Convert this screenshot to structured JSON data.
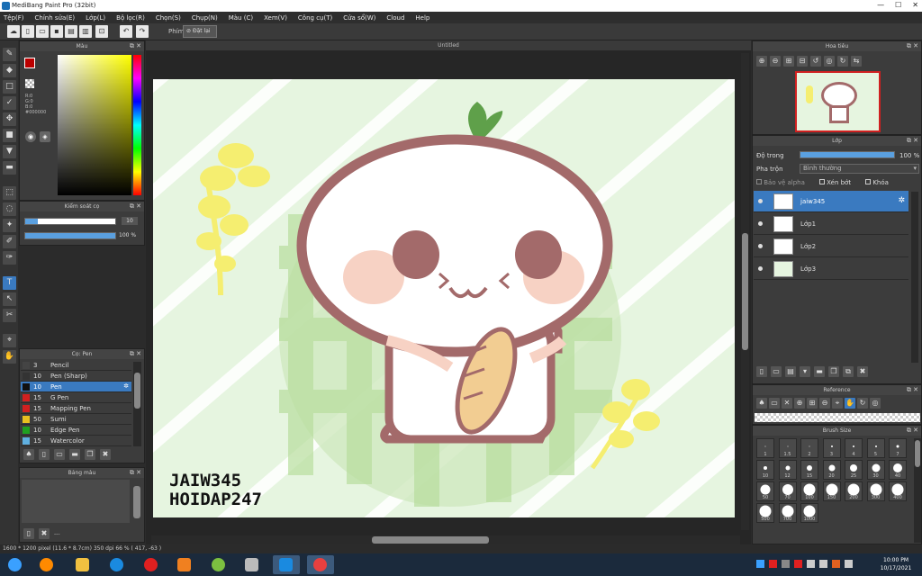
{
  "window": {
    "title": "MediBang Paint Pro (32bit)"
  },
  "menu": [
    "Tệp(F)",
    "Chỉnh sửa(E)",
    "Lớp(L)",
    "Bộ lọc(R)",
    "Chọn(S)",
    "Chụp(N)",
    "Màu (C)",
    "Xem(V)",
    "Công cụ(T)",
    "Cửa sổ(W)",
    "Cloud",
    "Help"
  ],
  "toolbar": {
    "brush_label": "Phím",
    "reset_label": "Đặt lại"
  },
  "color_panel": {
    "title": "Màu",
    "r": "R:0",
    "g": "G:0",
    "b": "B:0",
    "hex": "#000000"
  },
  "brush_control": {
    "title": "Kiểm soát cọ",
    "size_value": "10",
    "opacity_value": "100 %",
    "size_fill": 0.14,
    "opacity_fill": 1.0
  },
  "brush_panel": {
    "title": "Cọ: Pen",
    "items": [
      {
        "size": "3",
        "name": "Pencil",
        "color": "#444444"
      },
      {
        "size": "10",
        "name": "Pen (Sharp)",
        "color": "#333333"
      },
      {
        "size": "10",
        "name": "Pen",
        "color": "#111111",
        "selected": true
      },
      {
        "size": "15",
        "name": "G Pen",
        "color": "#d02020"
      },
      {
        "size": "15",
        "name": "Mapping Pen",
        "color": "#d02020"
      },
      {
        "size": "50",
        "name": "Sumi",
        "color": "#e8c020"
      },
      {
        "size": "10",
        "name": "Edge Pen",
        "color": "#20a020"
      },
      {
        "size": "15",
        "name": "Watercolor",
        "color": "#60b0e0"
      }
    ]
  },
  "palette_panel": {
    "title": "Bảng màu",
    "footer": "---"
  },
  "document": {
    "title": "Untitled",
    "signature_line1": "JAIW345",
    "signature_line2": "HOIDAP247"
  },
  "navigator": {
    "title": "Hoa tiêu"
  },
  "layer_panel": {
    "title": "Lớp",
    "opacity_label": "Độ trong",
    "opacity_value": "100 %",
    "blend_label": "Pha trộn",
    "blend_value": "Bình thường",
    "protect_alpha": "Bảo vệ alpha",
    "clipping": "Xén bớt",
    "lock": "Khóa",
    "layers": [
      {
        "name": "jaiw345",
        "selected": true
      },
      {
        "name": "Lớp1"
      },
      {
        "name": "Lớp2"
      },
      {
        "name": "Lớp3"
      }
    ]
  },
  "reference_panel": {
    "title": "Reference"
  },
  "brush_size_panel": {
    "title": "Brush Size",
    "sizes": [
      "1",
      "1.5",
      "2",
      "3",
      "4",
      "5",
      "7",
      "10",
      "12",
      "15",
      "20",
      "25",
      "30",
      "40",
      "50",
      "70",
      "100",
      "150",
      "200",
      "300",
      "400",
      "500",
      "700",
      "1000"
    ]
  },
  "statusbar": {
    "text": "1600 * 1200 pixel   (11.6 * 8.7cm)   350 dpi   66 %   ( 417, -63 )"
  },
  "taskbar": {
    "time": "10:00 PM",
    "date": "10/17/2021"
  }
}
